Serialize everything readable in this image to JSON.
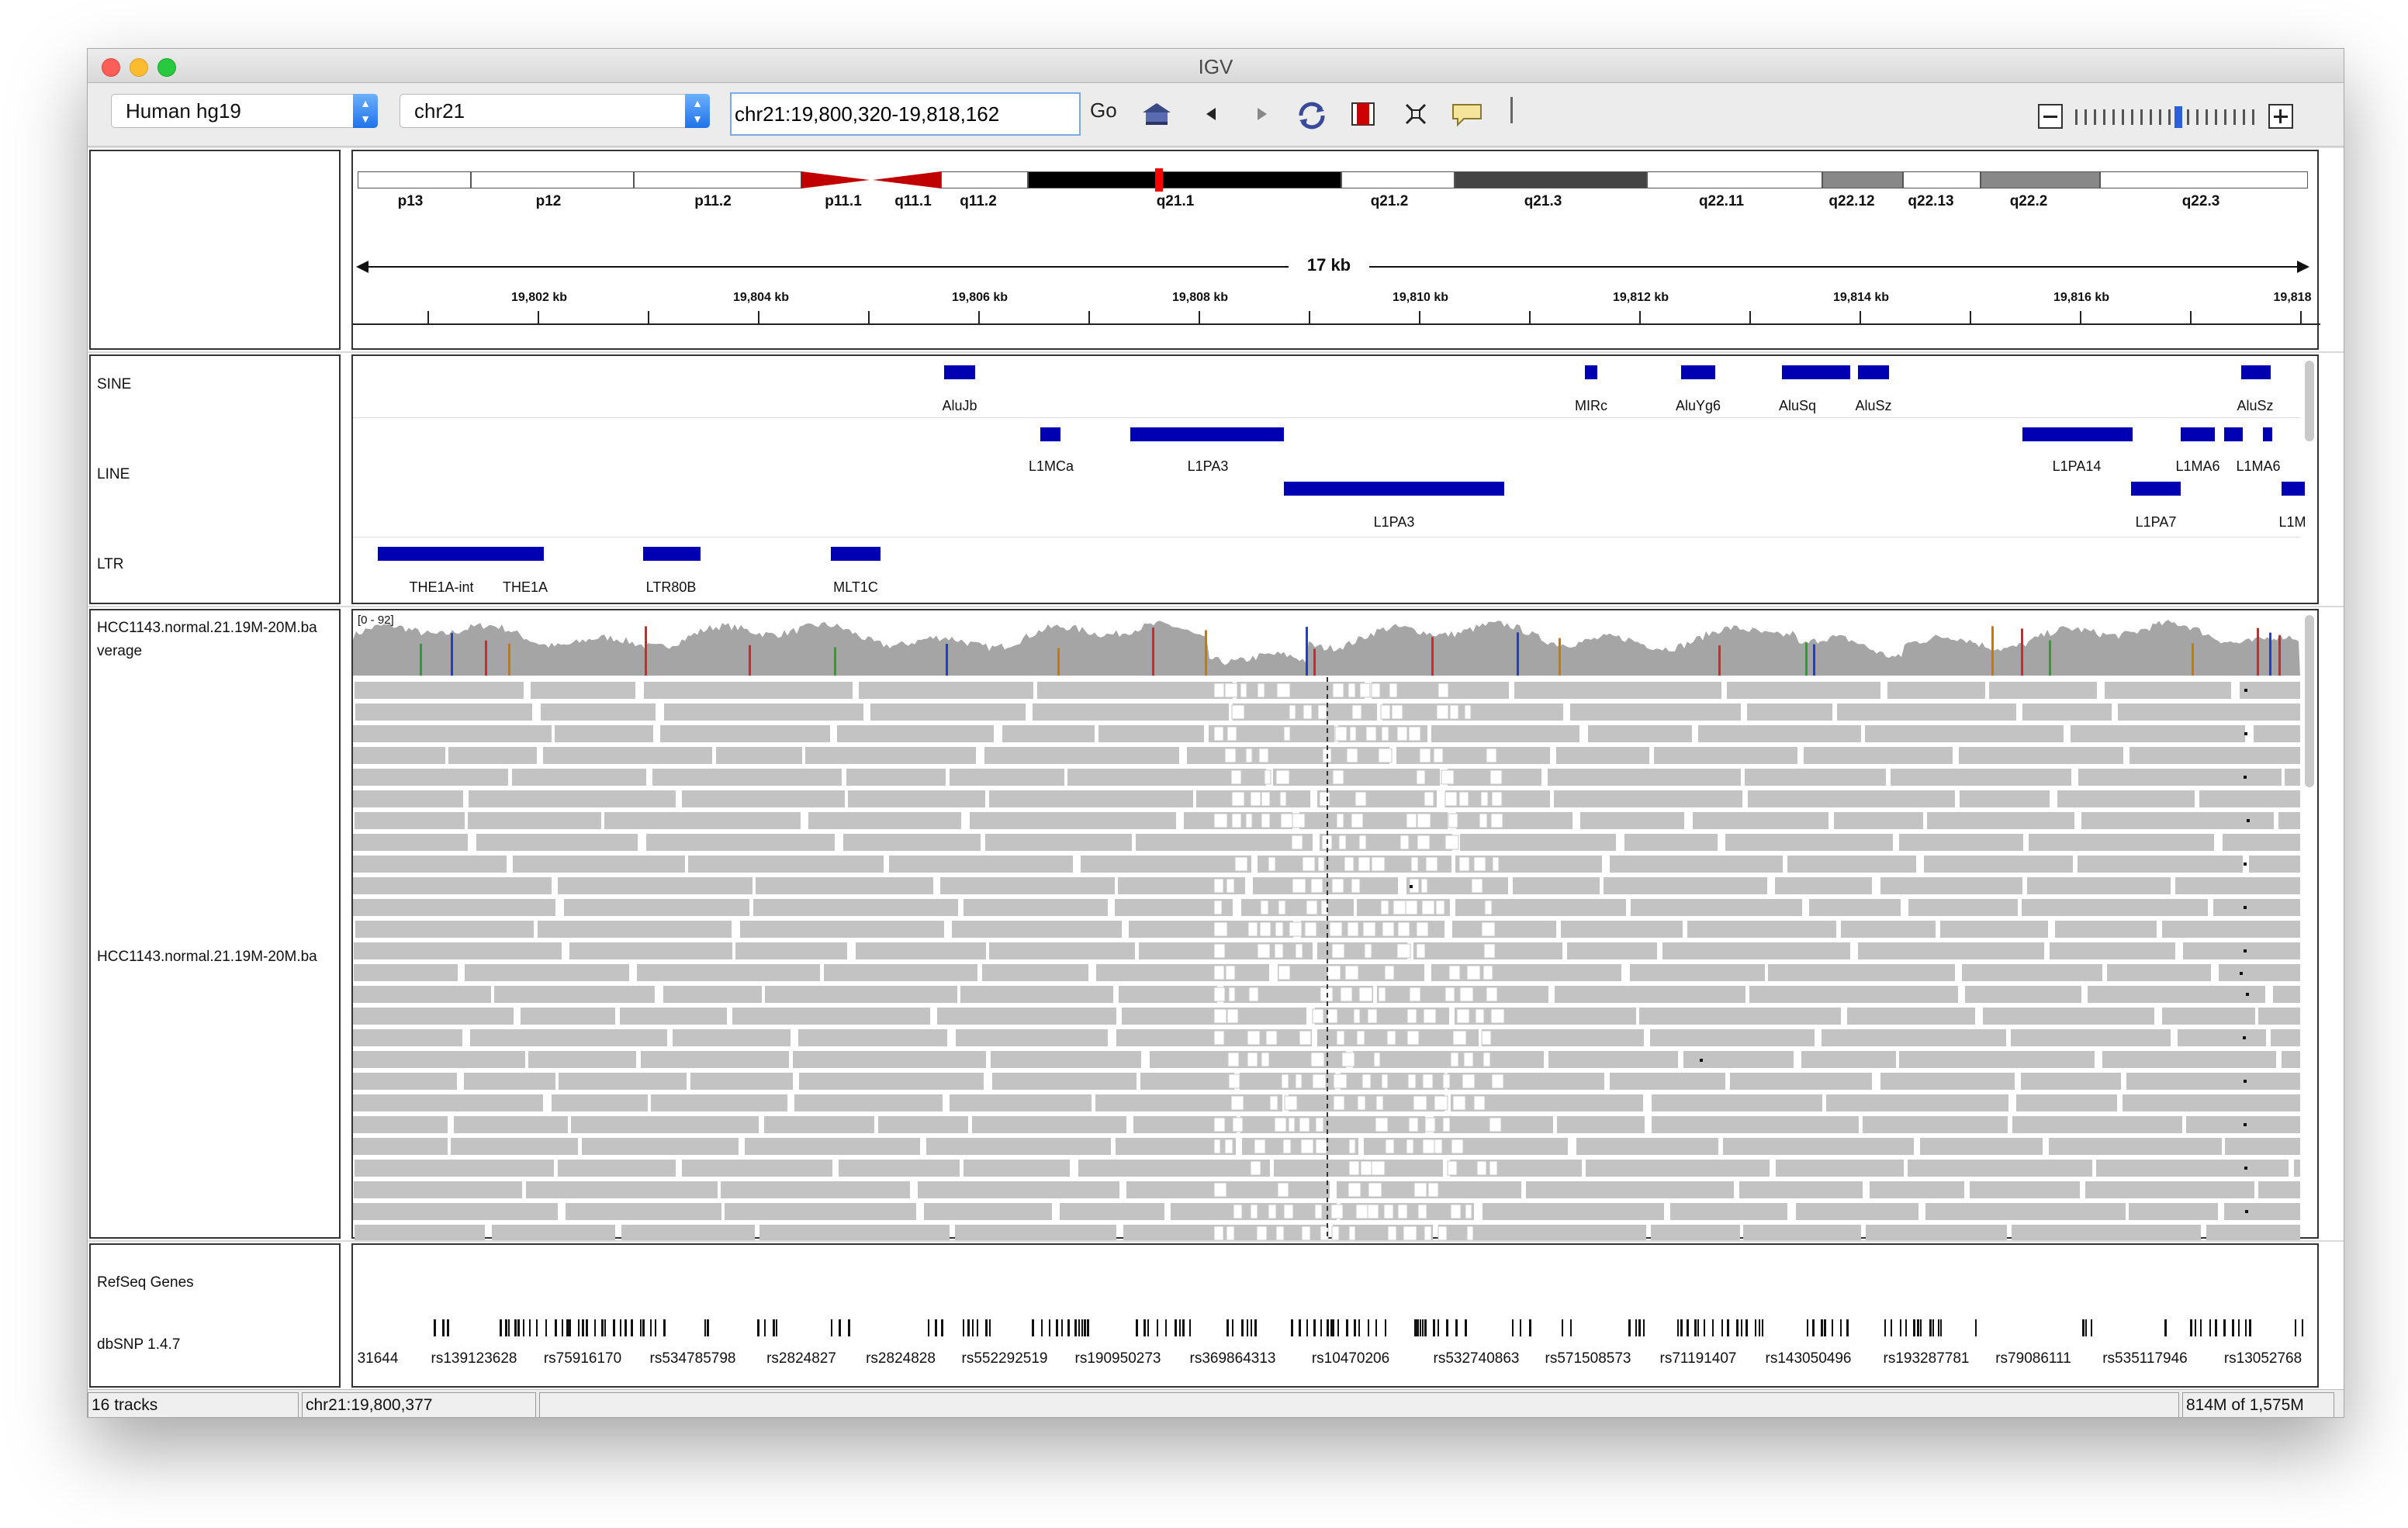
{
  "window": {
    "title": "IGV"
  },
  "toolbar": {
    "genome": "Human hg19",
    "chromosome": "chr21",
    "locus": "chr21:19,800,320-19,818,162",
    "go_label": "Go"
  },
  "ideogram": {
    "bands": [
      "p13",
      "p12",
      "p11.2",
      "p11.1",
      "q11.1",
      "q11.2",
      "q21.1",
      "q21.2",
      "q21.3",
      "q22.11",
      "q22.12",
      "q22.13",
      "q22.2",
      "q22.3"
    ]
  },
  "ruler": {
    "span_label": "17 kb",
    "ticks": [
      "19,802 kb",
      "19,804 kb",
      "19,806 kb",
      "19,808 kb",
      "19,810 kb",
      "19,812 kb",
      "19,814 kb",
      "19,816 kb",
      "19,818"
    ]
  },
  "repeat_tracks": {
    "names": [
      "SINE",
      "LINE",
      "LTR"
    ],
    "sine_labels": [
      "AluJb",
      "MIRc",
      "AluYg6",
      "AluSq",
      "AluSz",
      "AluSz"
    ],
    "line_labels": [
      "L1MCa",
      "L1PA3",
      "L1PA3",
      "L1PA14",
      "L1MA6",
      "L1MA6",
      "L1PA7",
      "L1M"
    ],
    "ltr_labels": [
      "THE1A-int",
      "THE1A",
      "LTR80B",
      "MLT1C"
    ]
  },
  "alignment_tracks": {
    "coverage_name_1": "HCC1143.normal.21.19M-20M.ba",
    "coverage_name_2": "verage",
    "coverage_range": "[0 - 92]",
    "reads_name": "HCC1143.normal.21.19M-20M.ba"
  },
  "annotation_tracks": {
    "refseq_name": "RefSeq Genes",
    "dbsnp_name": "dbSNP 1.4.7",
    "snp_labels": [
      "31644",
      "rs139123628",
      "rs75916170",
      "rs534785798",
      "rs2824827",
      "rs2824828",
      "rs552292519",
      "rs190950273",
      "rs369864313",
      "rs10470206",
      "rs532740863",
      "rs571508573",
      "rs71191407",
      "rs143050496",
      "rs193287781",
      "rs79086111",
      "rs535117946",
      "rs13052768"
    ]
  },
  "status": {
    "tracks": "16 tracks",
    "position": "chr21:19,800,377",
    "memory": "814M of 1,575M"
  },
  "colors": {
    "feature": "#0000b3",
    "read": "#c3c3c3",
    "coverage": "#a5a5a5",
    "centromere": "#c00000"
  },
  "icons": [
    "home-icon",
    "back-icon",
    "forward-icon",
    "refresh-icon",
    "roi-icon",
    "fit-icon",
    "popup-icon",
    "zoom-out-icon",
    "zoom-in-icon"
  ]
}
